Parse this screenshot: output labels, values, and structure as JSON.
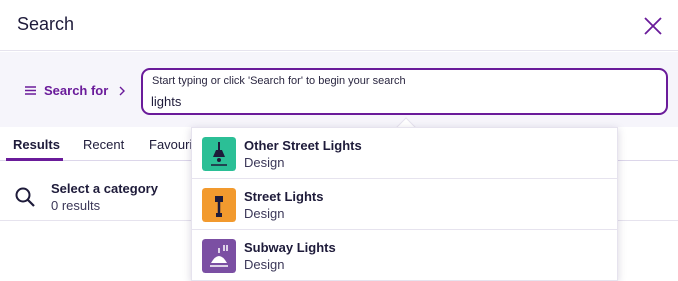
{
  "header": {
    "title": "Search",
    "close_icon": "close-icon"
  },
  "search": {
    "search_for_label": "Search for",
    "placeholder": "Start typing or click 'Search for' to begin your search",
    "value": "lights"
  },
  "tabs": [
    {
      "label": "Results",
      "active": true
    },
    {
      "label": "Recent",
      "active": false
    },
    {
      "label": "Favourit",
      "active": false
    }
  ],
  "category": {
    "title": "Select a category",
    "count": "0 results",
    "icon": "search-icon"
  },
  "suggestions": [
    {
      "name": "Other Street Lights",
      "type": "Design",
      "icon": "hanging-lamp-icon",
      "color": "#2bbf96"
    },
    {
      "name": "Street Lights",
      "type": "Design",
      "icon": "street-light-icon",
      "color": "#f29a2e"
    },
    {
      "name": "Subway Lights",
      "type": "Design",
      "icon": "subway-light-icon",
      "color": "#7b4fa3"
    }
  ],
  "colors": {
    "accent": "#6a1b9a",
    "text": "#1e1b3a"
  }
}
